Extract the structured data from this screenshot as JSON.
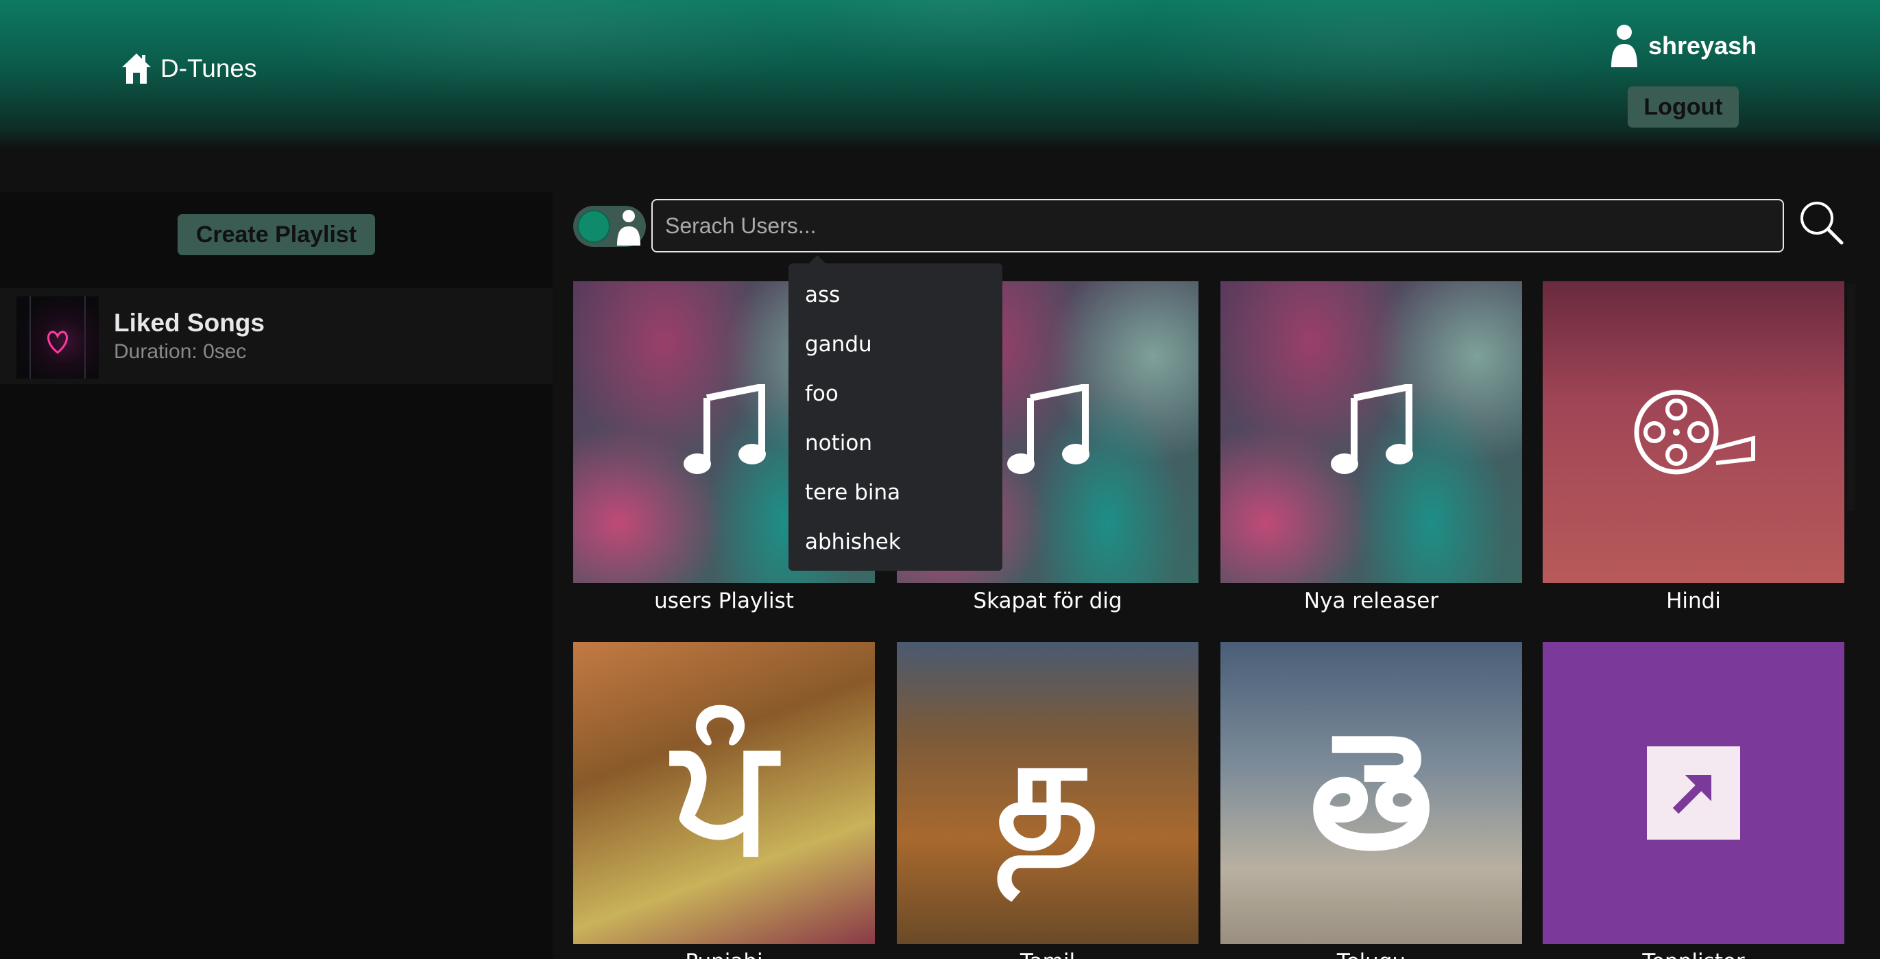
{
  "header": {
    "brand": "D-Tunes",
    "username": "shreyash",
    "logout_label": "Logout"
  },
  "sidebar": {
    "create_playlist_label": "Create Playlist",
    "playlists": [
      {
        "title": "Liked Songs",
        "subtitle": "Duration: 0sec"
      }
    ]
  },
  "search": {
    "placeholder": "Serach Users...",
    "value": "",
    "toggle_on": true,
    "suggestions": [
      "ass",
      "gandu",
      "foo",
      "notion",
      "tere bina",
      "abhishek"
    ]
  },
  "cards": [
    {
      "label": "users Playlist",
      "icon": "music-note-icon"
    },
    {
      "label": "Skapat för dig",
      "icon": "music-note-icon"
    },
    {
      "label": "Nya releaser",
      "icon": "music-note-icon"
    },
    {
      "label": "Hindi",
      "icon": "film-reel-icon"
    },
    {
      "label": "Punjabi",
      "glyph": "ਪੰ"
    },
    {
      "label": "Tamil",
      "glyph": "த"
    },
    {
      "label": "Telugu",
      "glyph": "తె"
    },
    {
      "label": "Topplistor",
      "icon": "arrow-up-right-icon"
    }
  ],
  "colors": {
    "accent": "#0d7a62",
    "button": "#3b5c53",
    "background": "#111111",
    "toplist": "#7b3a9a"
  }
}
